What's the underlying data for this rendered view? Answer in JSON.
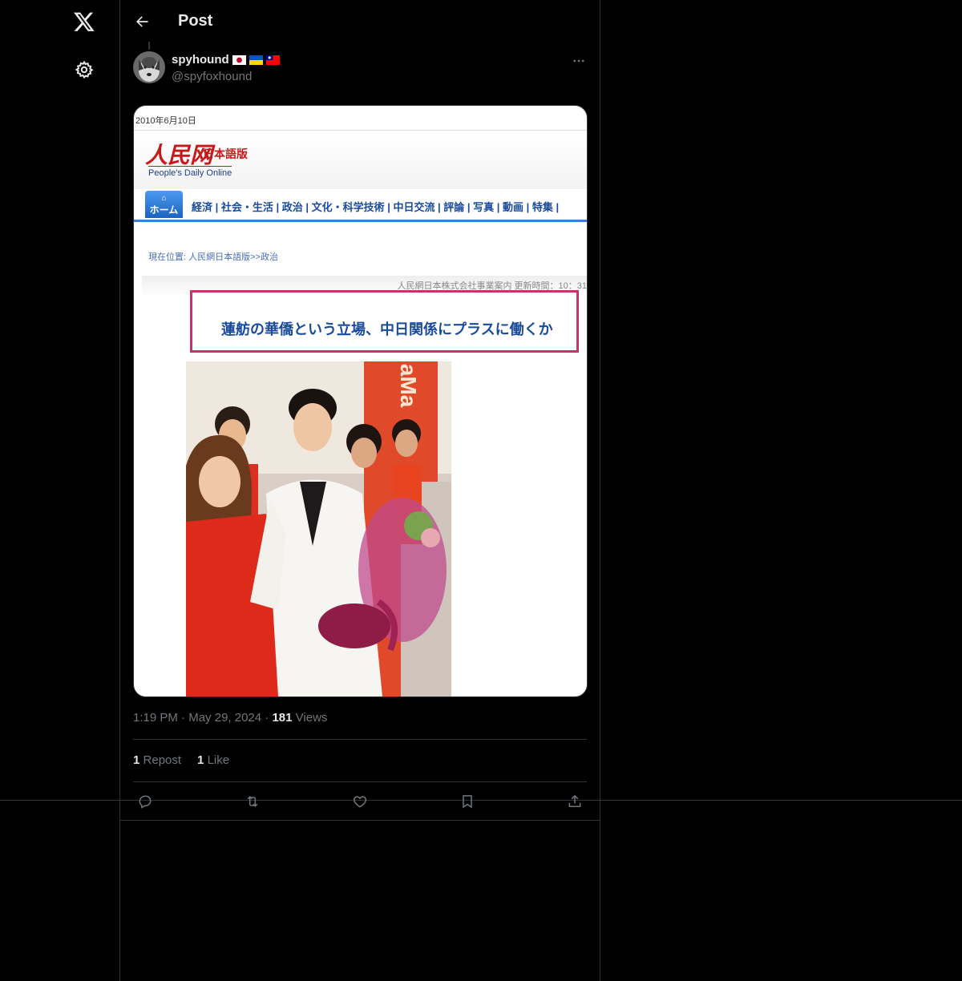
{
  "nav": {
    "logo_icon": "x-logo-icon",
    "settings_icon": "gear-icon"
  },
  "topbar": {
    "title": "Post"
  },
  "post": {
    "author_name": "spyhound",
    "author_handle": "@spyfoxhound",
    "flags": [
      "japan-flag",
      "ukraine-flag",
      "taiwan-flag"
    ],
    "time": "1:19 PM",
    "date": "May 29, 2024",
    "views_count": "181",
    "views_label": "Views",
    "reposts_count": "1",
    "reposts_label": "Repost",
    "likes_count": "1",
    "likes_label": "Like"
  },
  "media": {
    "date": "2010年6月10日",
    "logo_text": "人民网",
    "logo_sub": "日本語版",
    "tagline": "People's Daily Online",
    "home_label": "ホーム",
    "nav_items": "経済 | 社会・生活 | 政治 | 文化・科学技術 | 中日交流 | 評論 | 写真 | 動画 | 特集 |",
    "breadcrumb": "現在位置: 人民網日本語版>>政治",
    "company": "人民網日本株式会社事業案内 更新時間：10：31",
    "headline": "蓮舫の華僑という立場、中日関係にプラスに働くか",
    "photo_text": "aMa"
  },
  "colors": {
    "accent": "#1d9bf0",
    "muted": "#71767b",
    "border": "#2f3336"
  }
}
